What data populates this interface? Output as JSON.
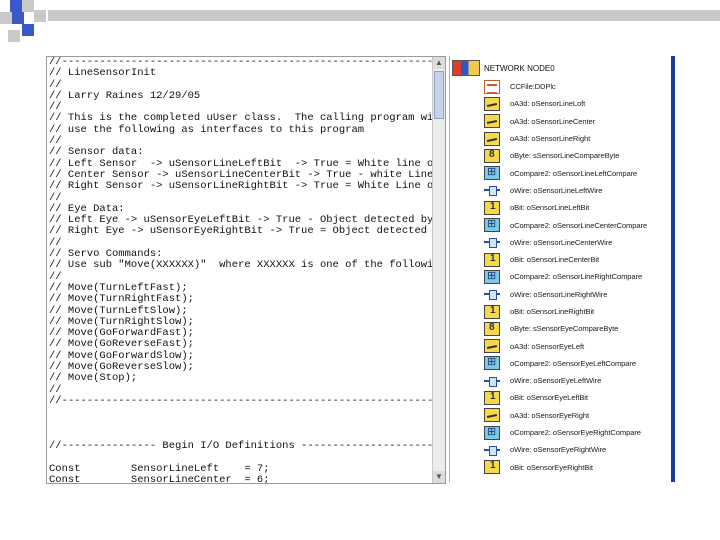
{
  "editor": {
    "code_lines": [
      "//-----------------------------------------------------------------",
      "// LineSensorInit",
      "//",
      "// Larry Raines 12/29/05",
      "//",
      "// This is the completed uUser class.  The calling program will",
      "// use the following as interfaces to this program",
      "//",
      "// Sensor data:",
      "// Left Sensor  -> uSensorLineLeftBit  -> True = White line on Lef",
      "// Center Sensor -> uSensorLineCenterBit -> True - white Line on",
      "// Right Sensor -> uSensorLineRightBit -> True = White Line on Rig",
      "//",
      "// Eye Data:",
      "// Left Eye -> uSensorEyeLeftBit -> True - Object detected by Lo",
      "// Right Eye -> uSensorEyeRightBit -> True = Object detected by",
      "//",
      "// Servo Commands:",
      "// Use sub \"Move(XXXXXX)\"  where XXXXXX is one of the following",
      "//",
      "// Move(TurnLeftFast);",
      "// Move(TurnRightFast);",
      "// Move(TurnLeftSlow);",
      "// Move(TurnRightSlow);",
      "// Move(GoForwardFast);",
      "// Move(GoReverseFast);",
      "// Move(GoForwardSlow);",
      "// Move(GoReverseSlow);",
      "// Move(Stop);",
      "//",
      "//-----------------------------------------------------------------",
      "",
      "",
      "",
      "//--------------- Begin I/O Definitions --------------------------",
      "",
      "Const        SensorLineLeft    = 7;",
      "Const        SensorLineCenter  = 6;"
    ],
    "scroll_up": "▲",
    "scroll_down": "▼"
  },
  "panel": {
    "header": "NETWORK NODE0",
    "items": [
      {
        "icon": "script-icon",
        "label": "CCFile:DDPlc"
      },
      {
        "icon": "analog-icon",
        "label": "oA3d: oSensorLineLoft"
      },
      {
        "icon": "analog-icon",
        "label": "oA3d: oSensorLineCenter"
      },
      {
        "icon": "analog-icon",
        "label": "oA3d: oSensorLineRight"
      },
      {
        "icon": "byte-icon",
        "label": "oByte: sSensorLineCompareByte"
      },
      {
        "icon": "compare-icon",
        "label": "oCompare2: oSensorLineLeftCompare"
      },
      {
        "icon": "wire-icon",
        "label": "oWire: oSensorLineLeftWire"
      },
      {
        "icon": "bit-icon",
        "label": "oBit: oSensorLineLeftBit"
      },
      {
        "icon": "compare-icon",
        "label": "oCompare2: oSensorLineCenterCompare"
      },
      {
        "icon": "wire-icon",
        "label": "oWire: oSensorLineCenterWire"
      },
      {
        "icon": "bit-icon",
        "label": "oBit: oSensorLineCenterBit"
      },
      {
        "icon": "compare-icon",
        "label": "oCompare2: oSensorLineRightCompare"
      },
      {
        "icon": "wire-icon",
        "label": "oWire: oSensorLineRightWire"
      },
      {
        "icon": "bit-icon",
        "label": "oBit: oSensorLineRightBit"
      },
      {
        "icon": "byte-icon",
        "label": "oByte: sSensorEyeCompareByte"
      },
      {
        "icon": "analog-icon",
        "label": "oA3d: oSensorEyeLeft"
      },
      {
        "icon": "compare-icon",
        "label": "oCompare2: oSensorEyeLeftCompare"
      },
      {
        "icon": "wire-icon",
        "label": "oWire: oSensorEyeLeftWire"
      },
      {
        "icon": "bit-icon",
        "label": "oBit: oSensorEyeLeftBit"
      },
      {
        "icon": "analog-icon",
        "label": "oA3d: oSensorEyeRight"
      },
      {
        "icon": "compare-icon",
        "label": "oCompare2: oSensorEyeRightCompare"
      },
      {
        "icon": "wire-icon",
        "label": "oWire: oSensorEyeRightWire"
      },
      {
        "icon": "bit-icon",
        "label": "oBit: oSensorEyeRightBit"
      }
    ]
  },
  "colors": {
    "deco_blue": "#3a58c8",
    "deco_gray": "#c9c9c9",
    "panel_edge": "#1b3d9c"
  }
}
